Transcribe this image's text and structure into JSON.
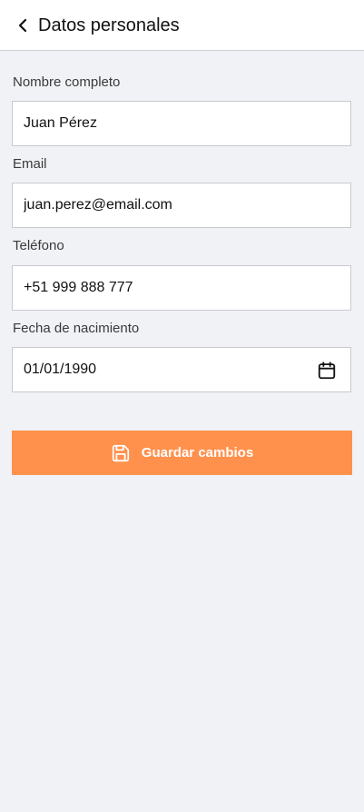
{
  "header": {
    "title": "Datos personales",
    "back_icon": "chevron-left-icon"
  },
  "form": {
    "fields": [
      {
        "label": "Nombre completo",
        "value": "Juan Pérez"
      },
      {
        "label": "Email",
        "value": "juan.perez@email.com"
      },
      {
        "label": "Teléfono",
        "value": "+51 999 888 777"
      },
      {
        "label": "Fecha de nacimiento",
        "value": "01/01/1990",
        "icon": "calendar-icon"
      }
    ]
  },
  "actions": {
    "save_label": "Guardar cambios",
    "save_icon": "floppy-disk-icon"
  },
  "colors": {
    "accent": "#ff914d",
    "background": "#f1f2f6",
    "surface": "#ffffff",
    "border": "#c9c9ce"
  }
}
